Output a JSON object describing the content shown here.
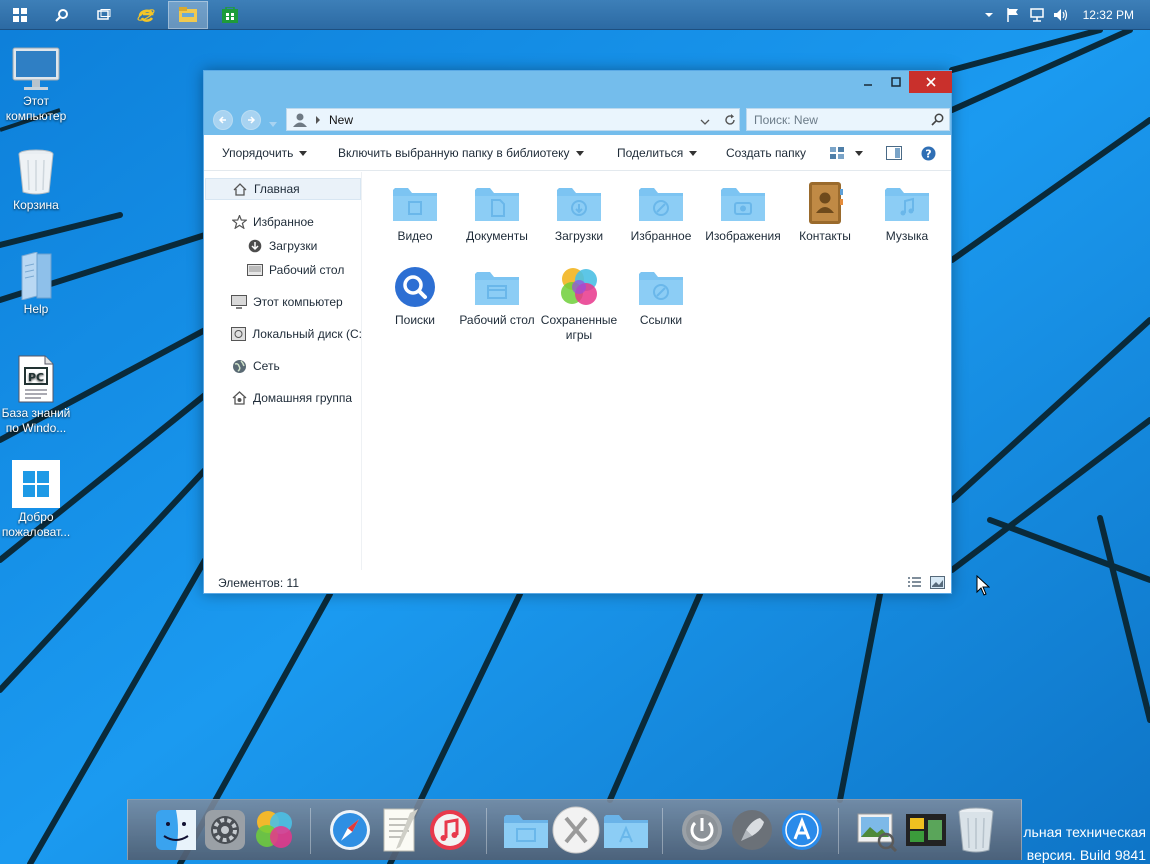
{
  "taskbar": {
    "apps": [
      {
        "name": "start-button"
      },
      {
        "name": "search"
      },
      {
        "name": "task-view"
      },
      {
        "name": "internet-explorer"
      },
      {
        "name": "file-explorer",
        "active": true
      },
      {
        "name": "store"
      }
    ],
    "clock": "12:32 PM"
  },
  "desktop": {
    "icons": [
      {
        "label": "Этот компьютер"
      },
      {
        "label": "Корзина"
      },
      {
        "label": "Help"
      },
      {
        "label": "База знаний по Windo..."
      },
      {
        "label": "Добро пожаловат..."
      }
    ],
    "watermark_line1": "льная техническая",
    "watermark_line2": "версия. Build 9841"
  },
  "explorer": {
    "address": {
      "path_segment": "New",
      "search_placeholder": "Поиск: New"
    },
    "commands": {
      "organize": "Упорядочить",
      "include_library": "Включить выбранную папку в библиотеку",
      "share": "Поделиться",
      "new_folder": "Создать папку"
    },
    "nav": {
      "home": "Главная",
      "favorites": "Избранное",
      "downloads": "Загрузки",
      "desktop": "Рабочий стол",
      "this_pc": "Этот компьютер",
      "local_disk": "Локальный диск (C:",
      "network": "Сеть",
      "homegroup": "Домашняя группа"
    },
    "items": [
      {
        "label": "Видео"
      },
      {
        "label": "Документы"
      },
      {
        "label": "Загрузки"
      },
      {
        "label": "Избранное"
      },
      {
        "label": "Изображения"
      },
      {
        "label": "Контакты"
      },
      {
        "label": "Музыка"
      },
      {
        "label": "Поиски"
      },
      {
        "label": "Рабочий стол"
      },
      {
        "label": "Сохраненные игры"
      },
      {
        "label": "Ссылки"
      }
    ],
    "status": "Элементов: 11"
  },
  "colors": {
    "accent": "#74bdec",
    "close_button": "#c9302c",
    "desktop": "#1a8fe0",
    "folder": "#7cc4f2"
  }
}
